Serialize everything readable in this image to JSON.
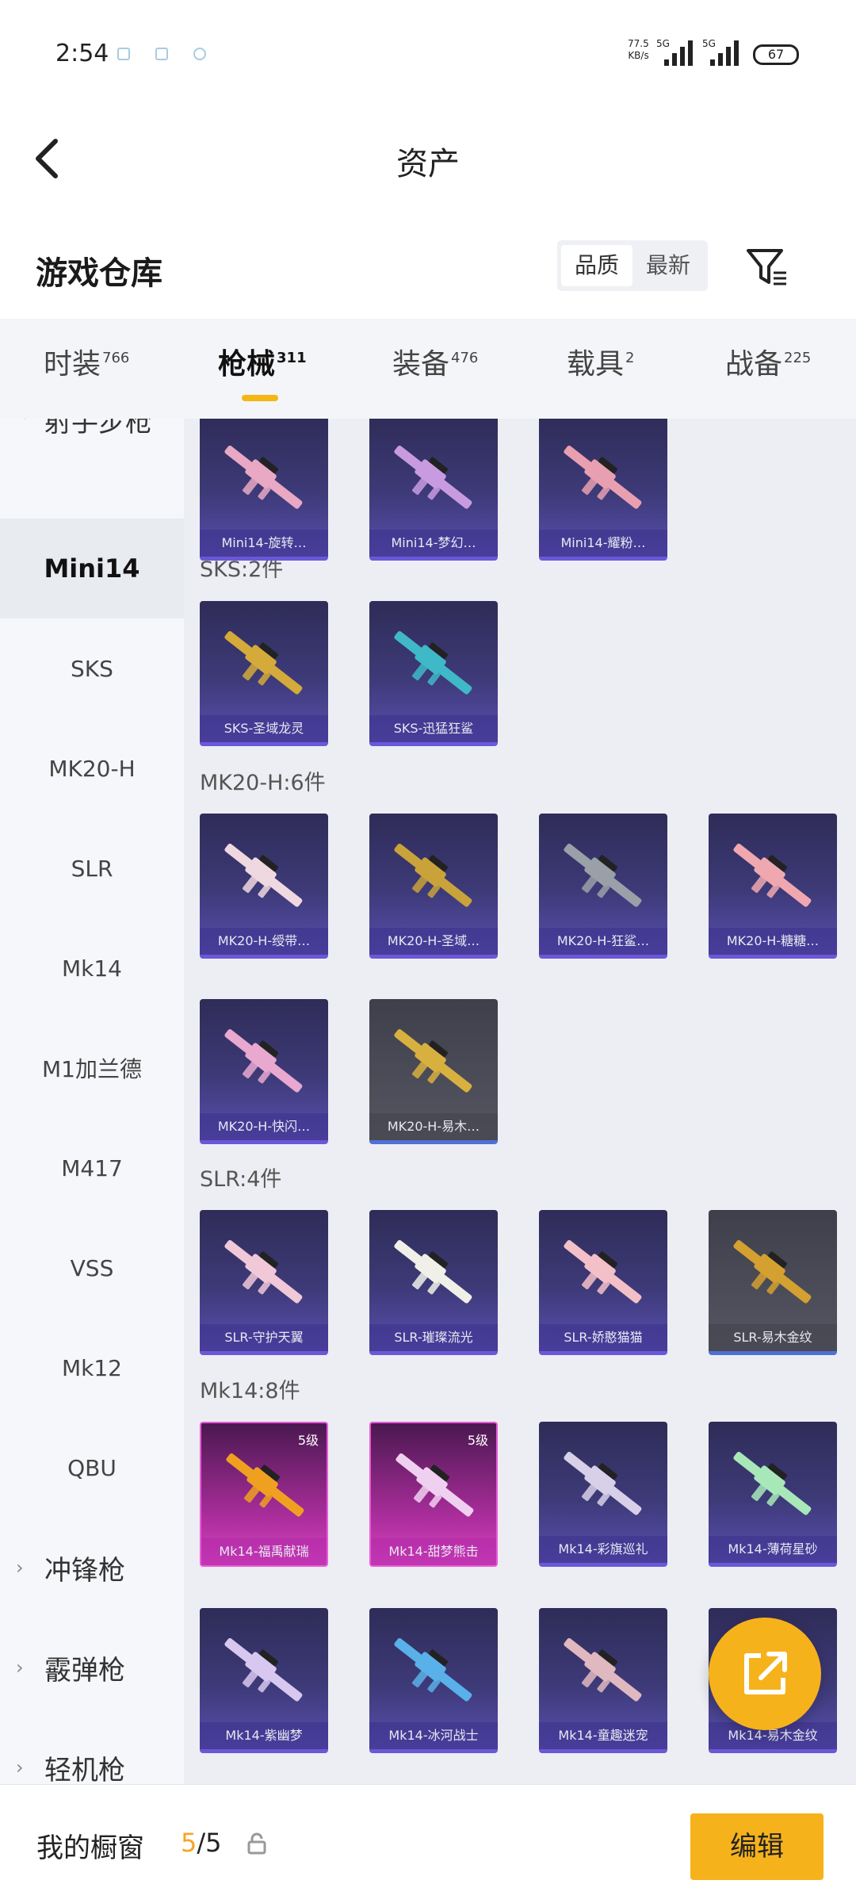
{
  "status_bar": {
    "time": "2:54",
    "net_speed_value": "77.5",
    "net_speed_unit": "KB/s",
    "network1": "5G",
    "network2": "5G",
    "battery": "67"
  },
  "header": {
    "title": "资产"
  },
  "warehouse": {
    "title": "游戏仓库",
    "sort_options": [
      "品质",
      "最新"
    ],
    "active_sort": "品质"
  },
  "category_tabs": [
    {
      "label": "时装",
      "count": "766"
    },
    {
      "label": "枪械",
      "count": "311",
      "active": true
    },
    {
      "label": "装备",
      "count": "476"
    },
    {
      "label": "载具",
      "count": "2"
    },
    {
      "label": "战备",
      "count": "225"
    }
  ],
  "sidebar": {
    "items": [
      {
        "label": "射手步枪",
        "type": "group"
      },
      {
        "label": "Mini14",
        "type": "sub",
        "selected": true
      },
      {
        "label": "SKS",
        "type": "sub"
      },
      {
        "label": "MK20-H",
        "type": "sub"
      },
      {
        "label": "SLR",
        "type": "sub"
      },
      {
        "label": "Mk14",
        "type": "sub"
      },
      {
        "label": "M1加兰德",
        "type": "sub"
      },
      {
        "label": "M417",
        "type": "sub"
      },
      {
        "label": "VSS",
        "type": "sub"
      },
      {
        "label": "Mk12",
        "type": "sub"
      },
      {
        "label": "QBU",
        "type": "sub"
      },
      {
        "label": "冲锋枪",
        "type": "group"
      },
      {
        "label": "霰弹枪",
        "type": "group"
      },
      {
        "label": "轻机枪",
        "type": "group"
      }
    ]
  },
  "grid": {
    "mini14_cards": [
      {
        "name": "Mini14-旋转…",
        "gun": "#e9a8c4"
      },
      {
        "name": "Mini14-梦幻…",
        "gun": "#c89be0"
      },
      {
        "name": "Mini14-耀粉…",
        "gun": "#e8a0b0"
      }
    ],
    "sks": {
      "title": "SKS:2件",
      "cards": [
        {
          "name": "SKS-圣域龙灵",
          "gun": "#d4aa3a"
        },
        {
          "name": "SKS-迅猛狂鲨",
          "gun": "#3fb8c8"
        }
      ]
    },
    "mk20": {
      "title": "MK20-H:6件",
      "cards": [
        {
          "name": "MK20-H-绶带…",
          "gun": "#f0d8e0"
        },
        {
          "name": "MK20-H-圣域…",
          "gun": "#c9a23a"
        },
        {
          "name": "MK20-H-狂鲨…",
          "gun": "#9aa0a8"
        },
        {
          "name": "MK20-H-糖糖…",
          "gun": "#f0a8b0"
        },
        {
          "name": "MK20-H-快闪…",
          "gun": "#e8a8d0"
        },
        {
          "name": "MK20-H-易木…",
          "gun": "#d8b040",
          "gray": true
        }
      ]
    },
    "slr": {
      "title": "SLR:4件",
      "cards": [
        {
          "name": "SLR-守护天翼",
          "gun": "#f0c8d8"
        },
        {
          "name": "SLR-璀璨流光",
          "gun": "#f0f0e8"
        },
        {
          "name": "SLR-娇憨猫猫",
          "gun": "#f4c0c8"
        },
        {
          "name": "SLR-易木金纹",
          "gun": "#d4a030",
          "gray": true
        }
      ]
    },
    "mk14": {
      "title": "Mk14:8件",
      "cards": [
        {
          "name": "Mk14-福禹献瑞",
          "gun": "#f0a020",
          "pink": true,
          "level": "5级"
        },
        {
          "name": "Mk14-甜梦熊击",
          "gun": "#f0d0f0",
          "pink": true,
          "level": "5级"
        },
        {
          "name": "Mk14-彩旗巡礼",
          "gun": "#d8d0e8"
        },
        {
          "name": "Mk14-薄荷星砂",
          "gun": "#a8e8b8"
        },
        {
          "name": "Mk14-紫幽梦",
          "gun": "#d8c8f0"
        },
        {
          "name": "Mk14-冰河战士",
          "gun": "#5ab0e8"
        },
        {
          "name": "Mk14-童趣迷宠",
          "gun": "#e0b8c0"
        },
        {
          "name": "Mk14-易木金纹",
          "gun": "#d4a030"
        }
      ]
    }
  },
  "bottom_bar": {
    "label": "我的橱窗",
    "current": "5",
    "total": "/5",
    "edit_label": "编辑"
  },
  "colors": {
    "accent": "#f6b21b",
    "card_purple": "#3d3a78",
    "card_pink": "#b02fa0"
  }
}
